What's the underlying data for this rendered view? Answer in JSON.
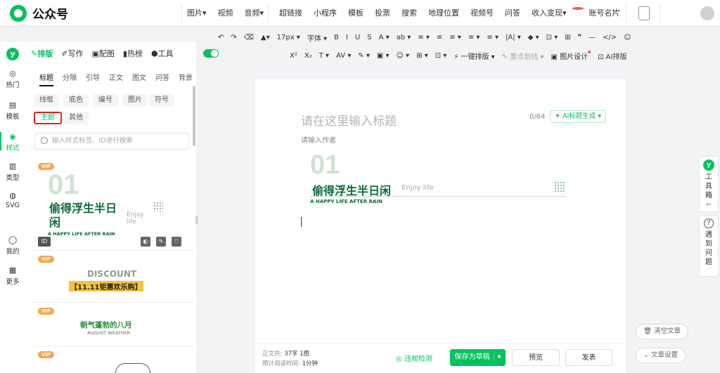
{
  "app": {
    "name": "公众号"
  },
  "topmenu": {
    "items_a": [
      "图片▾",
      "视频",
      "音频▾"
    ],
    "items_b": [
      "超链接",
      "小程序",
      "模板",
      "投票",
      "搜索",
      "地理位置",
      "视频号",
      "问答",
      "收入变现▾",
      "账号名片"
    ],
    "more": "⋯"
  },
  "format_toolbar": {
    "row1": [
      "↶",
      "↷",
      "⌫",
      "▲▾",
      "17px ▾",
      "字体 ▾",
      "B",
      "I",
      "U",
      "S",
      "A ▾",
      "ab ▾",
      "≡ ▾",
      "≡",
      "≡ ▾",
      "≡ ▾",
      "≡ ▾",
      "|A| ▾",
      "◆ ▾",
      "⊡ ▾",
      "⊞",
      "❞",
      "—",
      "</>",
      "☺"
    ],
    "row2": [
      "X²",
      "X₂",
      "T ▾",
      "AV ▾",
      "✎ ▾",
      "▣ ▾",
      "☺ ▾",
      "⊞ ▾",
      "⊡ ▾"
    ],
    "one_click": "一键排版",
    "highlight": "重点划线",
    "image_design": "图片设计",
    "ai_layout": "AI排版"
  },
  "side_tabs": {
    "items": [
      {
        "icon": "✎",
        "label": "排版"
      },
      {
        "icon": "✐",
        "label": "写作"
      },
      {
        "icon": "▣",
        "label": "配图"
      },
      {
        "icon": "▮",
        "label": "热榜"
      },
      {
        "icon": "⬢",
        "label": "工具"
      }
    ],
    "toggle_on": true
  },
  "leftnav": [
    {
      "icon": "◎",
      "label": "热门"
    },
    {
      "icon": "▤",
      "label": "模板"
    },
    {
      "icon": "◉",
      "label": "样式"
    },
    {
      "icon": "▥",
      "label": "类型"
    },
    {
      "icon": "◍",
      "label": "SVG"
    },
    {
      "icon": "◯",
      "label": "我的"
    },
    {
      "icon": "▦",
      "label": "更多"
    }
  ],
  "style_subtabs": [
    "标题",
    "分隔",
    "引导",
    "正文",
    "图文",
    "问答",
    "背景"
  ],
  "chips": [
    "线框",
    "底色",
    "编号",
    "图片",
    "符号",
    "主题",
    "其他"
  ],
  "search": {
    "placeholder": "输入样式标签、ID进行搜索"
  },
  "cards": {
    "card1": {
      "vip": "VIP",
      "num": "01",
      "title": "偷得浮生半日闲",
      "sub": "Enjoy life",
      "tag": "A HAPPY LIFE AFTER RAIN",
      "id": "ID"
    },
    "card2": {
      "vip": "VIP",
      "title": "DISCOUNT",
      "sub": "【11.11钜惠欢乐购】"
    },
    "card3": {
      "vip": "VIP",
      "title": "朝气蓬勃的八月",
      "sub": "AUGUST WEATHER"
    },
    "card4": {
      "vip": "VIP"
    }
  },
  "editor": {
    "title_placeholder": "请在这里输入标题",
    "title_counter": "0/64",
    "ai_title": "AI标题生成",
    "author_placeholder": "请输入作者",
    "block_num": "01",
    "block_title": "偷得浮生半日闲",
    "block_sub": "Enjoy life",
    "block_tag": "A HAPPY LIFE AFTER RAIN"
  },
  "bottom": {
    "word_label": "正文共:",
    "word_value": "37字 1图",
    "read_label": "预计阅读时间:",
    "read_value": "1分钟",
    "check": "违规检测",
    "save": "保存为草稿",
    "preview": "预览",
    "publish": "发表"
  },
  "right_tools": {
    "toolbox": "工具箱",
    "help": "遇到问题"
  },
  "float_buttons": {
    "clear": "清空文章",
    "settings": "文章设置"
  },
  "colors": {
    "brand": "#07c160",
    "title_green": "#0d6b3b",
    "light_green": "#cde3d6",
    "red": "#e02020",
    "vip": "#f7a64a"
  }
}
